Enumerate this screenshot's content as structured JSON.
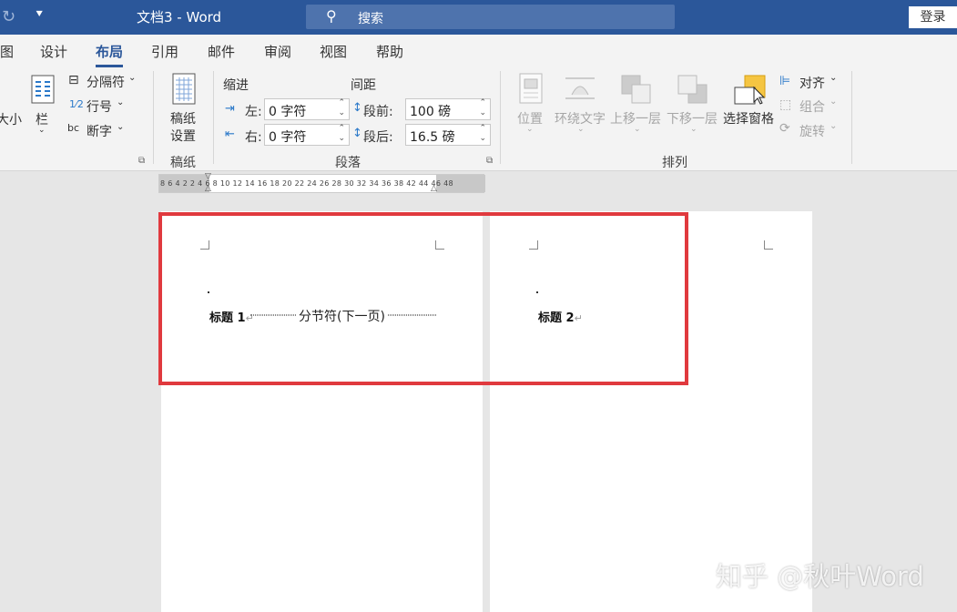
{
  "titlebar": {
    "doc_title": "文档3  -  Word",
    "search_placeholder": "搜索",
    "login_label": "登录"
  },
  "tabs": [
    {
      "label": "图"
    },
    {
      "label": "设计"
    },
    {
      "label": "布局",
      "active": true
    },
    {
      "label": "引用"
    },
    {
      "label": "邮件"
    },
    {
      "label": "审阅"
    },
    {
      "label": "视图"
    },
    {
      "label": "帮助"
    }
  ],
  "ribbon": {
    "page_setup": {
      "size_partial": "大小",
      "columns": "栏",
      "breaks": "分隔符",
      "line_numbers": "行号",
      "hyphenation": "断字"
    },
    "manuscript": {
      "button": "稿纸\n设置",
      "button_line1": "稿纸",
      "button_line2": "设置",
      "group_label": "稿纸"
    },
    "paragraph": {
      "indent_label": "缩进",
      "spacing_label": "间距",
      "left_label": "左:",
      "right_label": "右:",
      "left_value": "0 字符",
      "right_value": "0 字符",
      "before_label": "段前:",
      "after_label": "段后:",
      "before_value": "100 磅",
      "after_value": "16.5 磅",
      "group_label": "段落"
    },
    "arrange": {
      "position": "位置",
      "wrap_text": "环绕文字",
      "bring_forward": "上移一层",
      "send_backward": "下移一层",
      "selection_pane": "选择窗格",
      "align": "对齐",
      "group": "组合",
      "rotate": "旋转",
      "group_label": "排列"
    }
  },
  "ruler": {
    "numbers": "8  6  4  2          2   4   6   8  10 12 14 16 18 20 22 24 26 28 30 32 34 36 38          42 44 46 48"
  },
  "document": {
    "page1_heading": "标题 1",
    "section_break": "分节符(下一页)",
    "page2_heading": "标题 2"
  },
  "watermark": "知乎 @秋叶Word",
  "colors": {
    "accent": "#2b579a",
    "highlight_border": "#e0393e"
  }
}
